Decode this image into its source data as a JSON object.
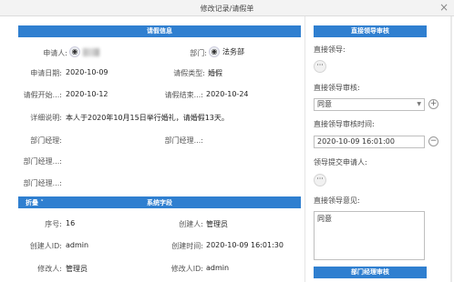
{
  "window": {
    "title": "修改记录/请假单",
    "close_glyph": "×"
  },
  "left": {
    "section_title": "请假信息",
    "fields": {
      "applicant_label": "申请人:",
      "dept_label": "部门:",
      "dept_value": "法务部",
      "apply_date_label": "申请日期:",
      "apply_date_value": "2020-10-09",
      "leave_type_label": "请假类型:",
      "leave_type_value": "婚假",
      "leave_start_label": "请假开始...:",
      "leave_start_value": "2020-10-12",
      "leave_end_label": "请假结束...:",
      "leave_end_value": "2020-10-24",
      "detail_label": "详细说明:",
      "detail_value": "本人于2020年10月15日举行婚礼，请婚假13天。",
      "dept_mgr1_label": "部门经理:",
      "dept_mgr2_label": "部门经理...:",
      "dept_mgr3_label": "部门经理...:",
      "dept_mgr4_label": "部门经理...:"
    },
    "fold": {
      "label": "折叠 ˅",
      "title": "系统字段"
    },
    "system": {
      "seq_label": "序号:",
      "seq_value": "16",
      "creator_label": "创建人:",
      "creator_value": "管理员",
      "creator_id_label": "创建人ID:",
      "creator_id_value": "admin",
      "created_time_label": "创建时间:",
      "created_time_value": "2020-10-09 16:01:30",
      "modifier_label": "修改人:",
      "modifier_value": "管理员",
      "modifier_id_label": "修改人ID:",
      "modifier_id_value": "admin"
    }
  },
  "right": {
    "section_title": "直接领导审核",
    "direct_leader_label": "直接领导:",
    "dots": "···",
    "approve_label": "直接领导审核:",
    "approve_value": "同意",
    "approve_time_label": "直接领导审核时间:",
    "approve_time_value": "2020-10-09 16:01:00",
    "submit_label": "领导提交申请人:",
    "opinion_label": "直接领导意见:",
    "opinion_value": "同意",
    "next_section_title": "部门经理审核",
    "plus": "+",
    "minus": "−"
  }
}
